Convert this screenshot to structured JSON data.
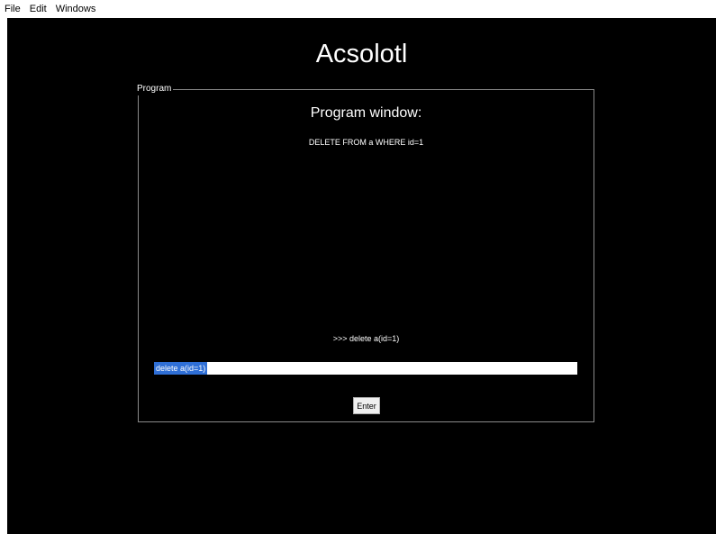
{
  "menubar": {
    "items": [
      {
        "label": "File"
      },
      {
        "label": "Edit"
      },
      {
        "label": "Windows"
      }
    ]
  },
  "app": {
    "title": "Acsolotl"
  },
  "program": {
    "group_label": "Program",
    "heading": "Program window:",
    "output": "DELETE FROM a WHERE id=1",
    "echo": ">>> delete a(id=1)",
    "input_value": "delete a(id=1)",
    "enter_label": "Enter"
  },
  "colors": {
    "background": "#000000",
    "selection": "#2f6fd6",
    "border": "#8a8a8a"
  }
}
